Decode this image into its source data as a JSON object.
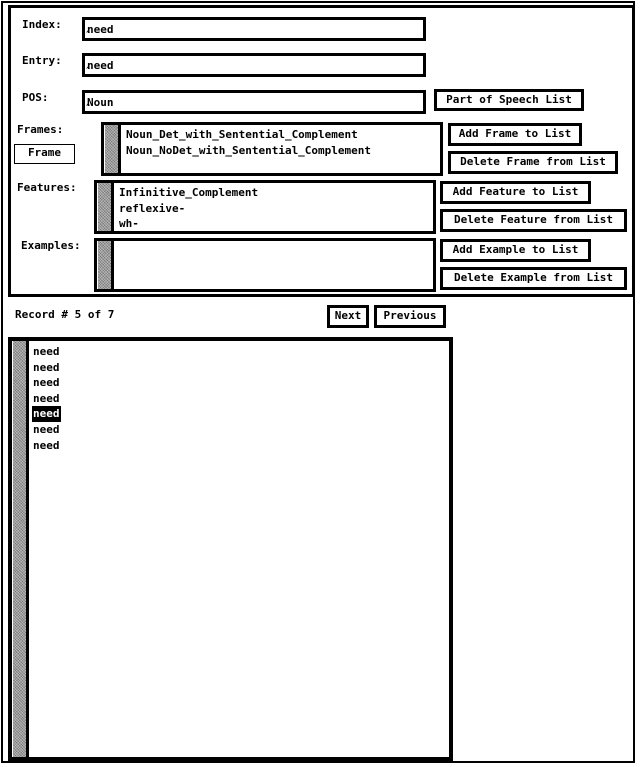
{
  "form": {
    "index": {
      "label": "Index:",
      "value": "need"
    },
    "entry": {
      "label": "Entry:",
      "value": "need"
    },
    "pos": {
      "label": "POS:",
      "value": "Noun",
      "list_button": "Part of Speech List"
    },
    "frames": {
      "label": "Frames:",
      "frame_button": "Frame",
      "items": [
        "Noun_Det_with_Sentential_Complement",
        "Noun_NoDet_with_Sentential_Complement"
      ],
      "add_button": "Add Frame to List",
      "delete_button": "Delete Frame from List"
    },
    "features": {
      "label": "Features:",
      "items": [
        "Infinitive_Complement",
        "reflexive-",
        "wh-"
      ],
      "add_button": "Add Feature to List",
      "delete_button": "Delete Feature from List"
    },
    "examples": {
      "label": "Examples:",
      "items": [],
      "add_button": "Add Example to List",
      "delete_button": "Delete Example from List"
    }
  },
  "navigation": {
    "record_status": "Record # 5 of 7",
    "current_record": 5,
    "total_records": 7,
    "next_button": "Next",
    "previous_button": "Previous"
  },
  "records": {
    "items": [
      "need",
      "need",
      "need",
      "need",
      "need",
      "need",
      "need"
    ],
    "selected_index": 4
  },
  "colors": {
    "foreground": "#000000",
    "background": "#ffffff",
    "scrollbar": "#999999",
    "selection_bg": "#000000",
    "selection_fg": "#ffffff"
  }
}
